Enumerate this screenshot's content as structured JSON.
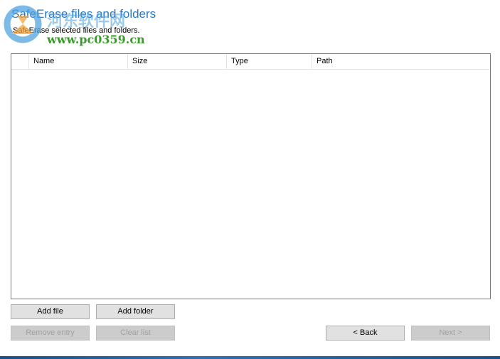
{
  "header": {
    "title": "SafeErase files and folders",
    "subtitle": "SafeErase selected files and folders."
  },
  "watermark": {
    "chinese_text": "河东软件网",
    "url": "www.pc0359.cn"
  },
  "table": {
    "columns": [
      "",
      "Name",
      "Size",
      "Type",
      "Path"
    ],
    "rows": []
  },
  "buttons": {
    "add_file": "Add file",
    "add_folder": "Add folder",
    "remove_entry": "Remove entry",
    "clear_list": "Clear list",
    "back": "< Back",
    "next": "Next >"
  },
  "states": {
    "remove_entry_enabled": false,
    "clear_list_enabled": false,
    "next_enabled": false
  },
  "colors": {
    "title": "#2b78c4",
    "button_bg": "#e1e1e1",
    "disabled_text": "#a0a0a0"
  }
}
